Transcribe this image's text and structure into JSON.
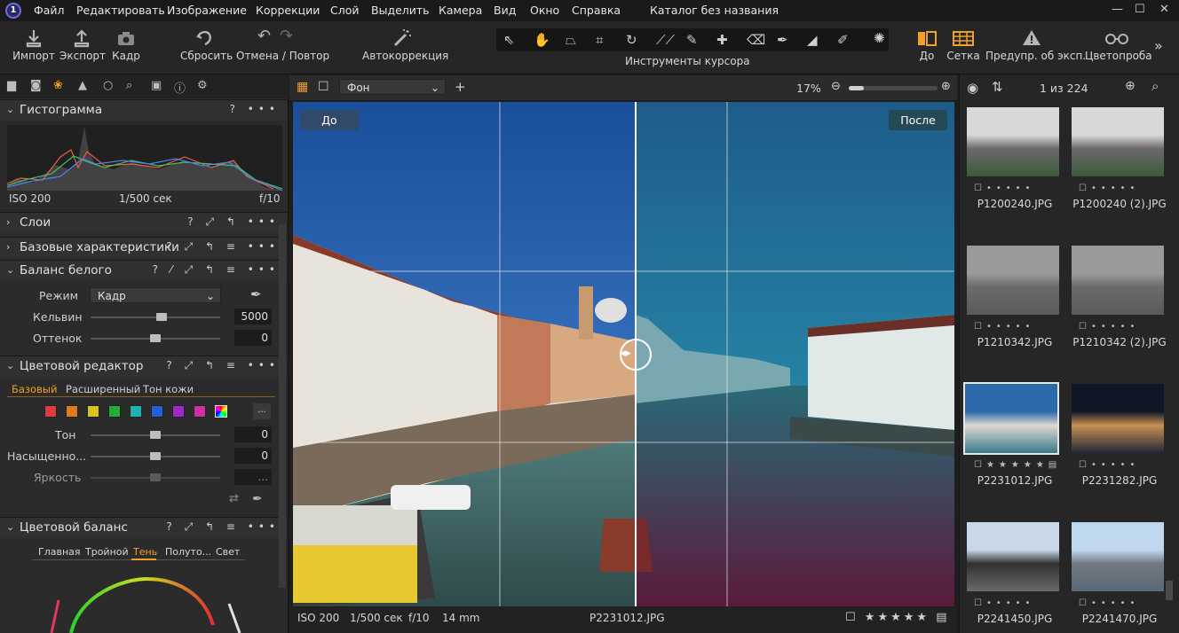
{
  "menu": {
    "items": [
      "Файл",
      "Редактировать",
      "Изображение",
      "Коррекции",
      "Слой",
      "Выделить",
      "Камера",
      "Вид",
      "Окно",
      "Справка"
    ],
    "window_title": "Каталог без названия"
  },
  "toolbar": {
    "import": "Импорт",
    "export": "Экспорт",
    "capture": "Кадр",
    "reset": "Сбросить",
    "undo_redo": "Отмена / Повтор",
    "autocorrect": "Автокоррекция",
    "cursor_tools": "Инструменты курсора",
    "before": "До",
    "grid": "Сетка",
    "exposure_warning": "Предупр. об эксп.",
    "color_picker": "Цветопроба"
  },
  "histogram": {
    "title": "Гистограмма",
    "iso": "ISO 200",
    "shutter": "1/500 сек",
    "aperture": "f/10"
  },
  "layers": {
    "title": "Слои"
  },
  "basic": {
    "title": "Базовые характеристики"
  },
  "white_balance": {
    "title": "Баланс белого",
    "mode_label": "Режим",
    "mode_value": "Кадр",
    "kelvin_label": "Кельвин",
    "kelvin_value": "5000",
    "kelvin_level": 0.55,
    "tint_label": "Оттенок",
    "tint_value": "0",
    "tint_level": 0.5
  },
  "color_editor": {
    "title": "Цветовой редактор",
    "tabs": [
      "Базовый",
      "Расширенный",
      "Тон кожи"
    ],
    "active_tab": "Базовый",
    "swatches": [
      "#e03a48",
      "#e07a1e",
      "#d8c41c",
      "#22aa3a",
      "#1fb2a8",
      "#2060d8",
      "#a02ac8",
      "#d030a0"
    ],
    "more": "...",
    "hue_label": "Тон",
    "hue_value": "0",
    "sat_label": "Насыщенно...",
    "sat_value": "0",
    "bright_label": "Яркость",
    "bright_value": "..."
  },
  "color_balance": {
    "title": "Цветовой баланс",
    "tabs": [
      "Главная",
      "Тройной",
      "Тень",
      "Полуто...",
      "Свет"
    ],
    "active_tab": "Тень"
  },
  "viewer": {
    "background_select": "Фон",
    "zoom": "17%",
    "zoom_level": 0.17,
    "before_label": "До",
    "after_label": "После",
    "footer": {
      "iso": "ISO 200",
      "shutter": "1/500 сек",
      "aperture": "f/10",
      "focal": "14 mm",
      "filename": "P2231012.JPG"
    }
  },
  "browser": {
    "counter": "1 из 224",
    "thumbnails": [
      {
        "name": "P1200240.JPG"
      },
      {
        "name": "P1200240 (2).JPG"
      },
      {
        "name": "P1210342.JPG"
      },
      {
        "name": "P1210342 (2).JPG"
      },
      {
        "name": "P2231012.JPG"
      },
      {
        "name": "P2231282.JPG"
      },
      {
        "name": "P2241450.JPG"
      },
      {
        "name": "P2241470.JPG"
      }
    ]
  },
  "colors": {
    "accent": "#f0a028",
    "selected_border": "#e8e8e8",
    "panel": "#2b2b2b"
  }
}
